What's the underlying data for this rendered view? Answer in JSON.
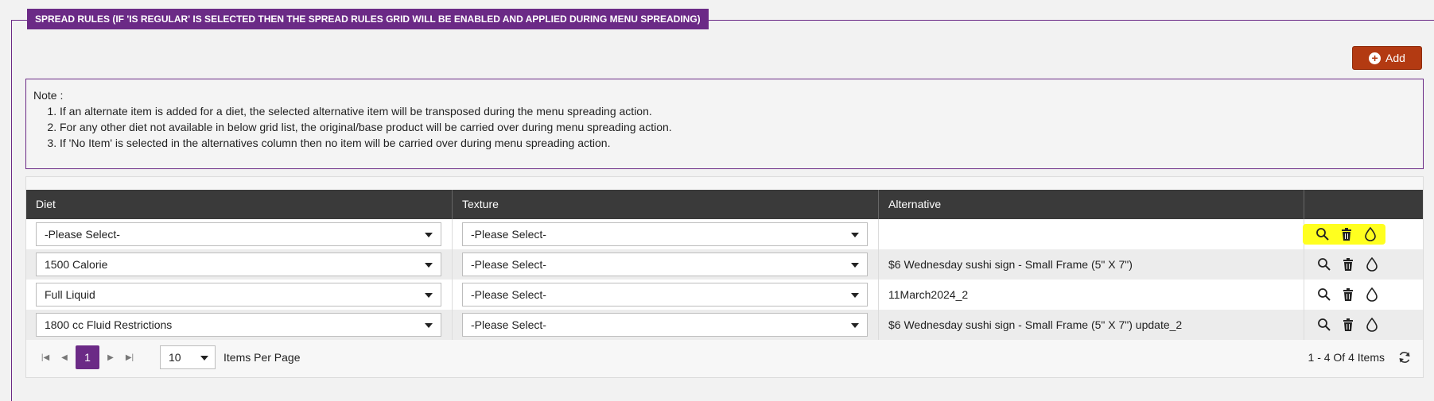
{
  "section": {
    "legend": "SPREAD RULES (IF 'IS REGULAR' IS SELECTED THEN THE SPREAD RULES GRID WILL BE ENABLED AND APPLIED DURING MENU SPREADING)"
  },
  "toolbar": {
    "add_label": "Add"
  },
  "note": {
    "title": "Note :",
    "items": [
      "If an alternate item is added for a diet, the selected alternative item will be transposed during the menu spreading action.",
      "For any other diet not available in below grid list, the original/base product will be carried over during menu spreading action.",
      "If 'No Item' is selected in the alternatives column then no item will be carried over during menu spreading action."
    ]
  },
  "grid": {
    "columns": [
      "Diet",
      "Texture",
      "Alternative",
      ""
    ],
    "rows": [
      {
        "diet": "-Please Select-",
        "texture": "-Please Select-",
        "alternative": ""
      },
      {
        "diet": "1500 Calorie",
        "texture": "-Please Select-",
        "alternative": "$6 Wednesday sushi sign - Small Frame (5\" X 7\")"
      },
      {
        "diet": "Full Liquid",
        "texture": "-Please Select-",
        "alternative": "11March2024_2"
      },
      {
        "diet": "1800 cc Fluid Restrictions",
        "texture": "-Please Select-",
        "alternative": "$6 Wednesday sushi sign - Small Frame (5\" X 7\") update_2"
      }
    ],
    "row_icons": [
      "search-icon",
      "trash-icon",
      "drop-icon"
    ]
  },
  "pager": {
    "current_page": "1",
    "page_size": "10",
    "page_size_label": "Items Per Page",
    "info": "1 - 4 Of 4 Items"
  },
  "colors": {
    "brand": "#6b2a86",
    "add_button": "#b33a12",
    "header_bg": "#3a3a3a",
    "highlight": "#ffff1f"
  }
}
